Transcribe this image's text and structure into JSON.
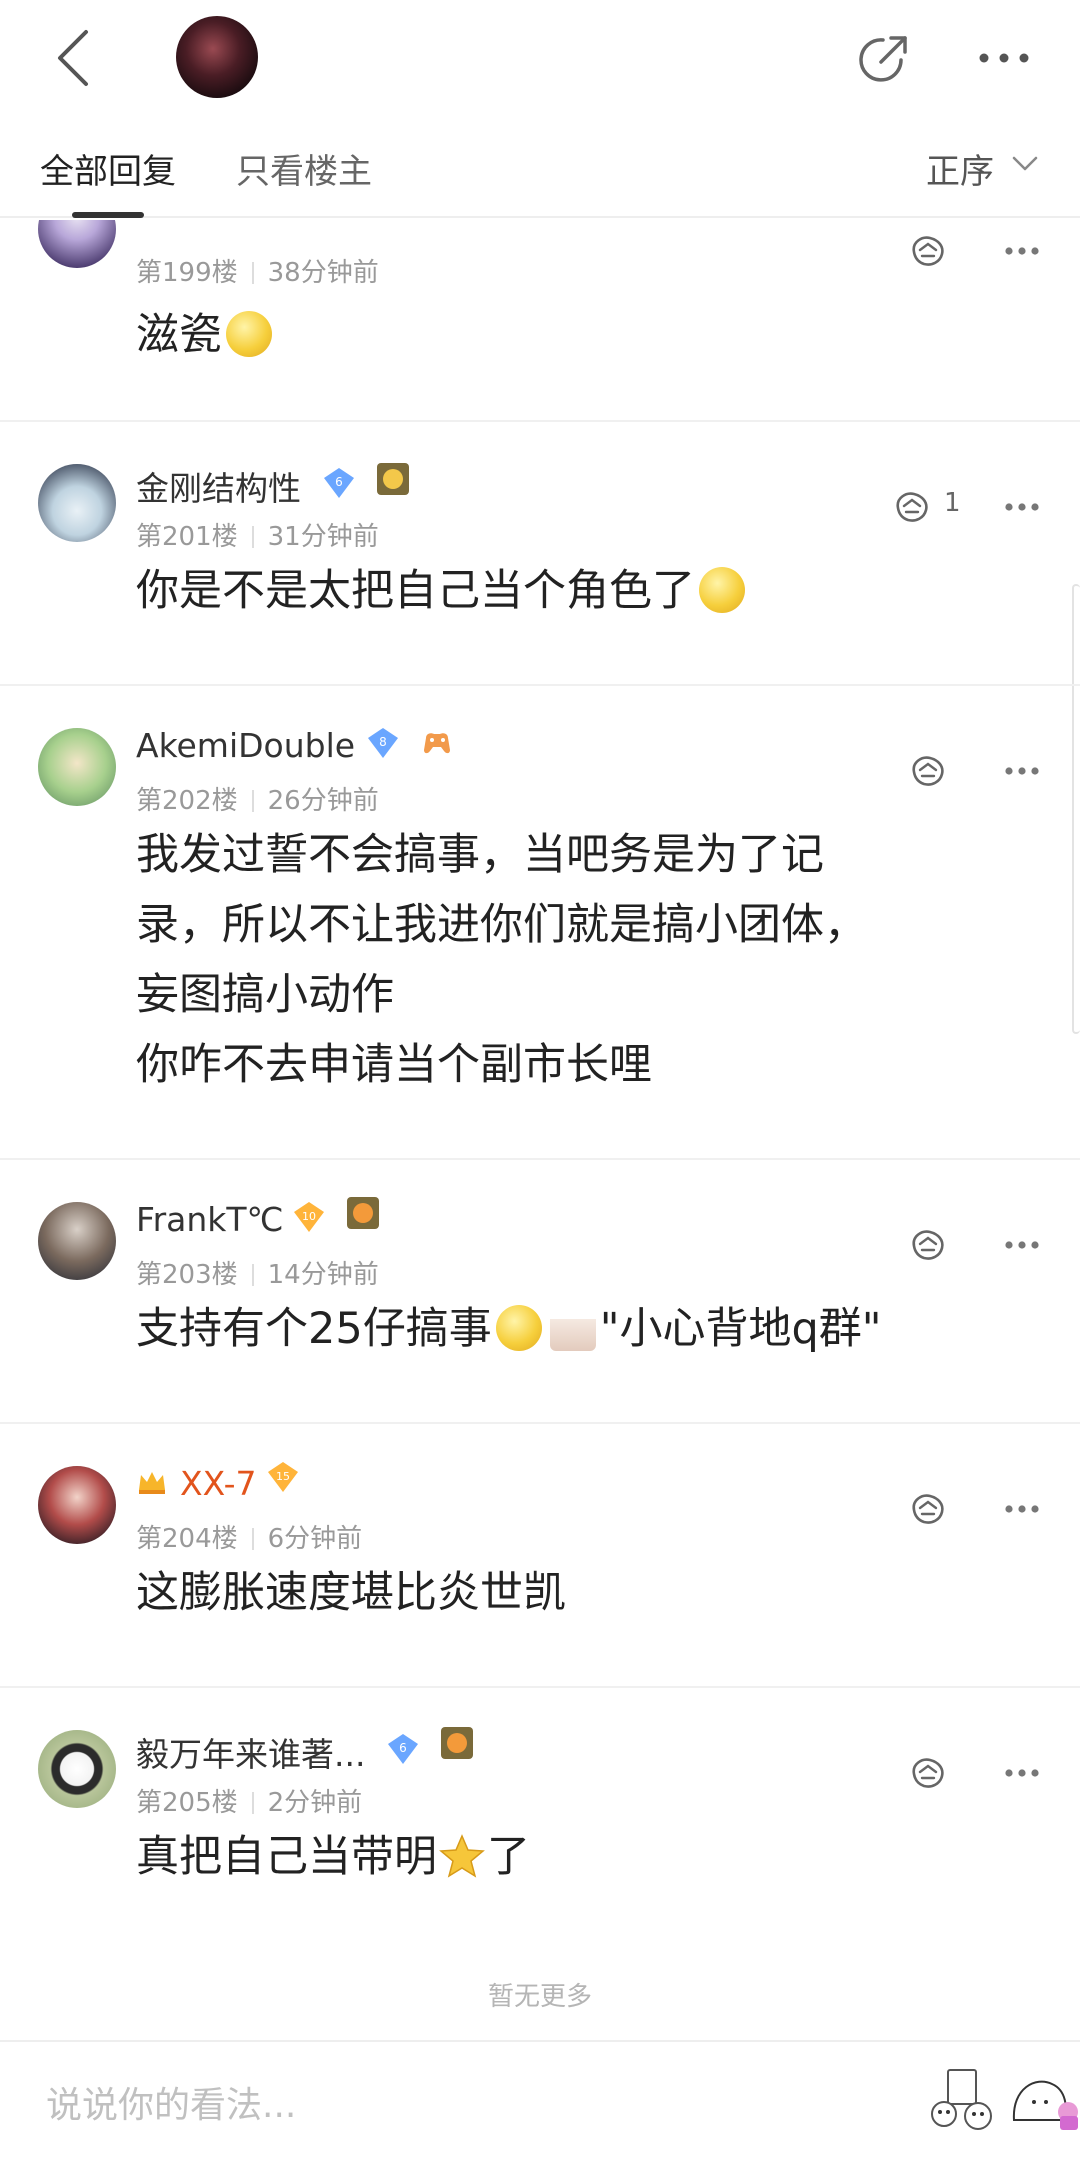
{
  "header": {
    "back_icon": "chevron-left-icon",
    "share_icon": "share-arrow-icon",
    "more_icon": "more-horizontal-icon"
  },
  "tabs": {
    "all": "全部回复",
    "owner_only": "只看楼主",
    "sort": "正序"
  },
  "posts": [
    {
      "floor": "第199楼",
      "time": "38分钟前",
      "text": "滋瓷",
      "likes": ""
    },
    {
      "username": "金刚结构性",
      "level": "6",
      "floor": "第201楼",
      "time": "31分钟前",
      "text": "你是不是太把自己当个角色了",
      "likes": "1"
    },
    {
      "username": "AkemiDouble",
      "level": "8",
      "floor": "第202楼",
      "time": "26分钟前",
      "text": "我发过誓不会搞事，当吧务是为了记\n录，所以不让我进你们就是搞小团体，\n妄图搞小动作\n你咋不去申请当个副市长哩",
      "likes": ""
    },
    {
      "username": "FrankT℃",
      "level": "10",
      "floor": "第203楼",
      "time": "14分钟前",
      "text_a": "支持有个25仔搞事",
      "text_b": "\"小心背地q群\"",
      "likes": ""
    },
    {
      "username": "XX-7",
      "level": "15",
      "floor": "第204楼",
      "time": "6分钟前",
      "text": "这膨胀速度堪比炎世凯",
      "likes": ""
    },
    {
      "username": "毅万年来谁著...",
      "level": "6",
      "floor": "第205楼",
      "time": "2分钟前",
      "text_a": "真把自己当带明",
      "text_b": "了",
      "likes": ""
    }
  ],
  "footer": {
    "no_more": "暂无更多",
    "input_placeholder": "说说你的看法..."
  },
  "colors": {
    "vip_name": "#e2541c",
    "level_blue": "#6aa6ff",
    "level_orange": "#ffb43a"
  }
}
